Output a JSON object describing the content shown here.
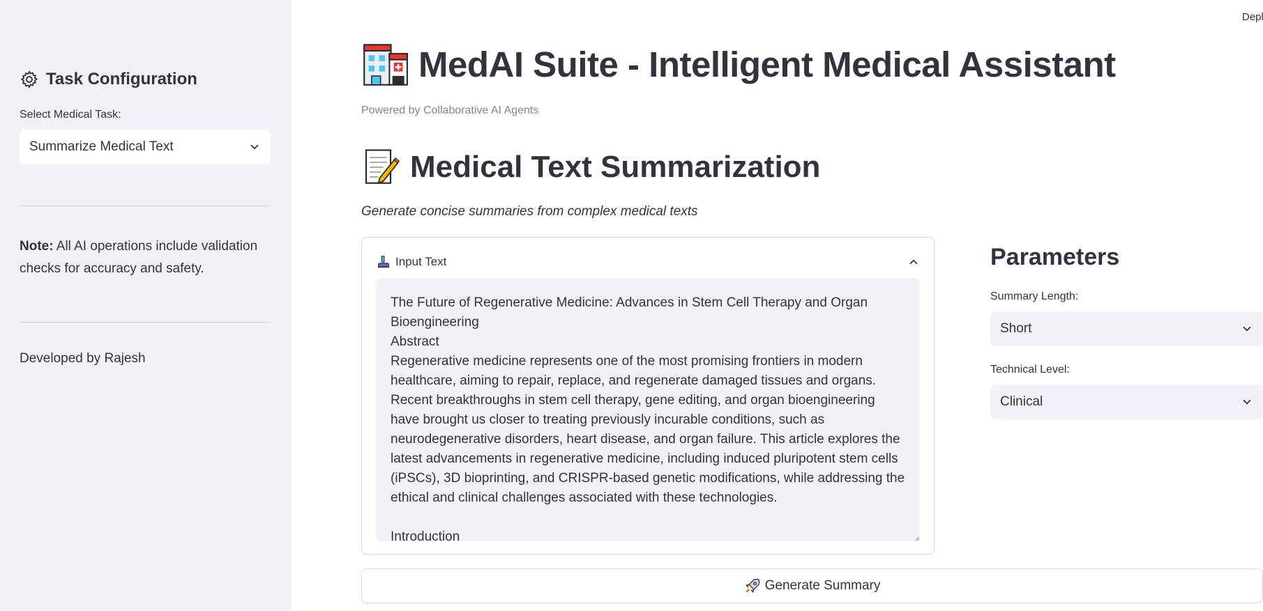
{
  "sidebar": {
    "heading": "Task Configuration",
    "task_label": "Select Medical Task:",
    "task_value": "Summarize Medical Text",
    "note_bold": "Note:",
    "note_text": " All AI operations include validation checks for accuracy and safety.",
    "developer": "Developed by Rajesh"
  },
  "header": {
    "deploy_text": "Deploy",
    "title": "MedAI Suite - Intelligent Medical Assistant",
    "subtitle": "Powered by Collaborative AI Agents"
  },
  "section": {
    "title": "Medical Text Summarization",
    "description": "Generate concise summaries from complex medical texts"
  },
  "input": {
    "expander_label": "Input Text",
    "text": "The Future of Regenerative Medicine: Advances in Stem Cell Therapy and Organ Bioengineering\nAbstract\nRegenerative medicine represents one of the most promising frontiers in modern healthcare, aiming to repair, replace, and regenerate damaged tissues and organs. Recent breakthroughs in stem cell therapy, gene editing, and organ bioengineering have brought us closer to treating previously incurable conditions, such as neurodegenerative disorders, heart disease, and organ failure. This article explores the latest advancements in regenerative medicine, including induced pluripotent stem cells (iPSCs), 3D bioprinting, and CRISPR-based genetic modifications, while addressing the ethical and clinical challenges associated with these technologies.\n\nIntroduction"
  },
  "parameters": {
    "title": "Parameters",
    "summary_length_label": "Summary Length:",
    "summary_length_value": "Short",
    "technical_level_label": "Technical Level:",
    "technical_level_value": "Clinical"
  },
  "actions": {
    "generate_label": "Generate Summary"
  },
  "icons": {
    "heading": "gear-icon",
    "title": "hospital-icon",
    "section": "memo-icon",
    "expander": "microscope-icon",
    "button": "rocket-icon"
  }
}
